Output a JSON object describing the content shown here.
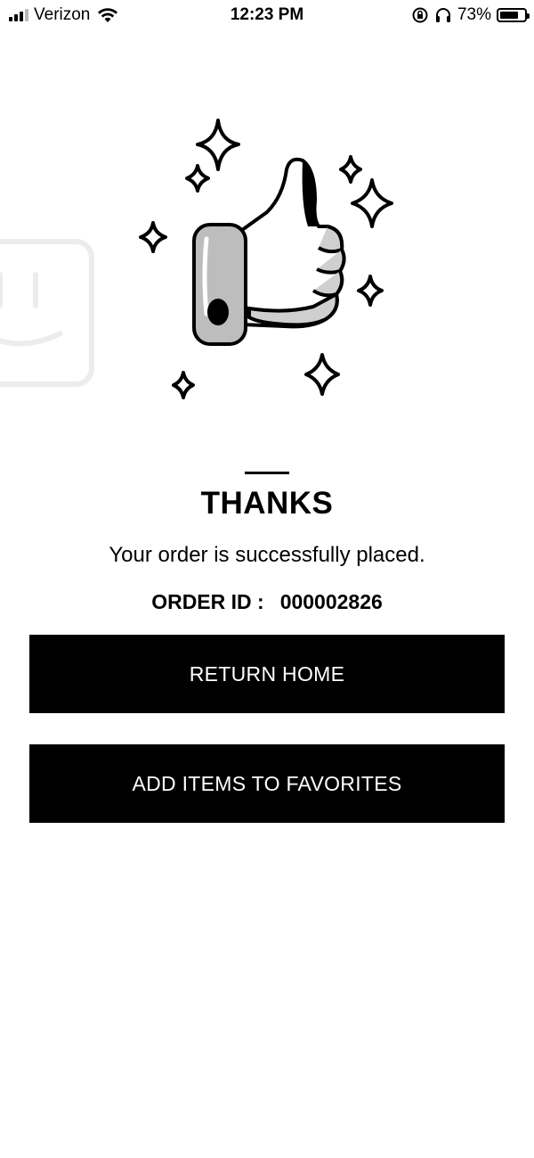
{
  "status_bar": {
    "carrier": "Verizon",
    "time": "12:23 PM",
    "battery_percent": "73%",
    "battery_level": 0.73,
    "icons": [
      "signal-icon",
      "wifi-icon",
      "orientation-lock-icon",
      "headphones-icon",
      "battery-icon"
    ]
  },
  "confirmation": {
    "illustration": "thumbs-up-with-sparkles",
    "title": "THANKS",
    "message": "Your order is successfully placed.",
    "order_id_label": "ORDER ID :",
    "order_id_value": "000002826"
  },
  "actions": {
    "return_home_label": "RETURN HOME",
    "add_favorites_label": "ADD ITEMS TO FAVORITES"
  },
  "colors": {
    "background": "#ffffff",
    "button_background": "#000000",
    "button_text": "#ffffff",
    "text": "#000000"
  }
}
